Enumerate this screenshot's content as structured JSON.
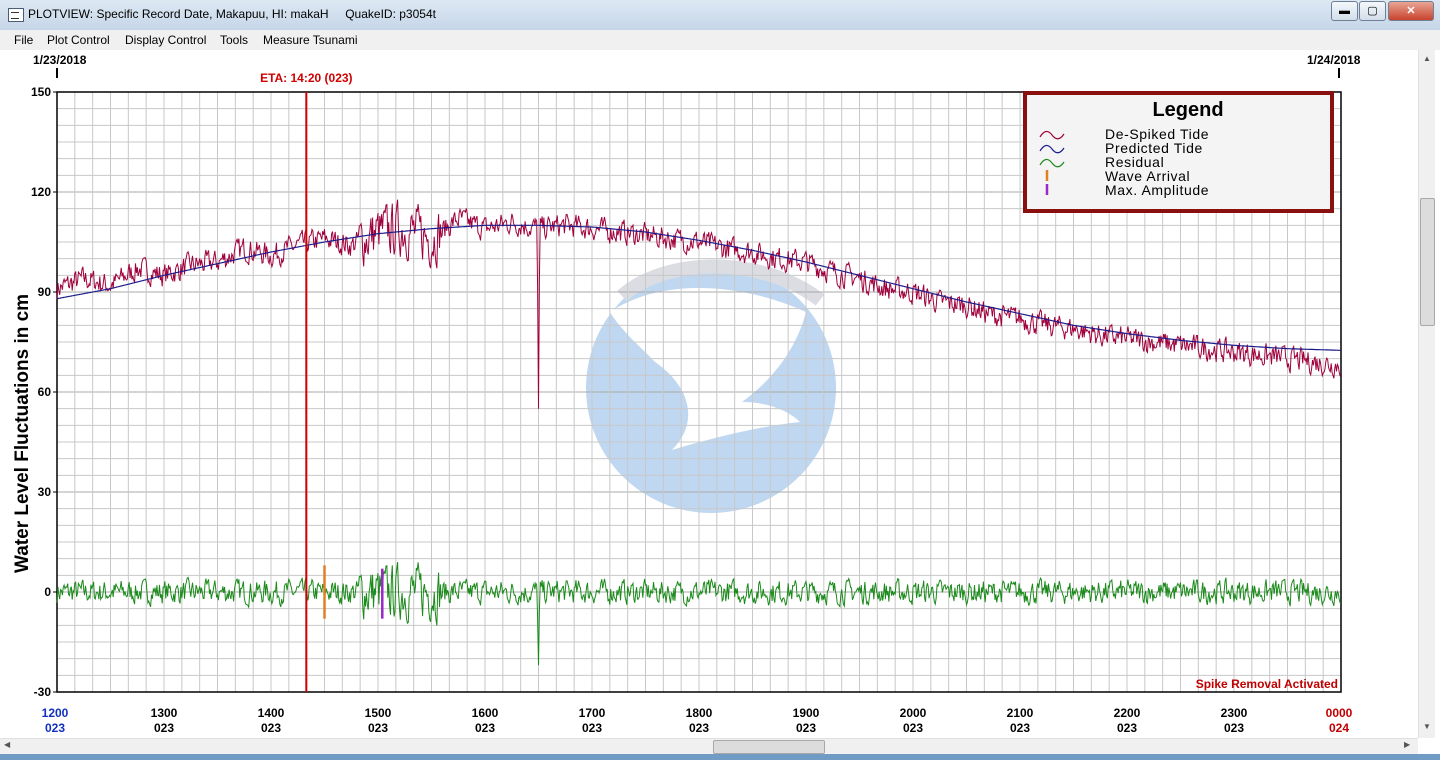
{
  "window": {
    "title": "PLOTVIEW: Specific Record Date, Makapuu, HI: makaH     QuakeID: p3054t",
    "minimize_label": "▬",
    "maximize_label": "▢",
    "close_label": "✕"
  },
  "menu": [
    "File",
    "Plot Control",
    "Display Control",
    "Tools",
    "Measure Tsunami"
  ],
  "colors": {
    "tide": "#a0003c",
    "predicted": "#1a1a8c",
    "residual": "#1a8a1a",
    "eta_line": "#d00000",
    "wave_arrival": "#e08020",
    "max_amplitude": "#9a28c8",
    "grid": "#c8c8c8",
    "legend_border": "#8a1010"
  },
  "chart_data": {
    "type": "line",
    "title": "",
    "ylabel": "Water Level Fluctuations in cm",
    "ylim": [
      -30,
      150
    ],
    "yticks": [
      150,
      120,
      90,
      60,
      30,
      0,
      -30
    ],
    "xlim": [
      12,
      24
    ],
    "start_date": "1/23/2018",
    "end_date": "1/24/2018",
    "x_tick_labels": [
      {
        "time": "1200",
        "day": "023"
      },
      {
        "time": "1300",
        "day": "023"
      },
      {
        "time": "1400",
        "day": "023"
      },
      {
        "time": "1500",
        "day": "023"
      },
      {
        "time": "1600",
        "day": "023"
      },
      {
        "time": "1700",
        "day": "023"
      },
      {
        "time": "1800",
        "day": "023"
      },
      {
        "time": "1900",
        "day": "023"
      },
      {
        "time": "2000",
        "day": "023"
      },
      {
        "time": "2100",
        "day": "023"
      },
      {
        "time": "2200",
        "day": "023"
      },
      {
        "time": "2300",
        "day": "023"
      },
      {
        "time": "0000",
        "day": "024"
      }
    ],
    "eta": {
      "label": "ETA: 14:20 (023)",
      "hour": 14.33
    },
    "wave_arrival_hour": 14.5,
    "max_amplitude_hour": 15.04,
    "status_text": "Spike Removal Activated",
    "legend": {
      "title": "Legend",
      "entries": [
        "De-Spiked Tide",
        "Predicted Tide",
        "Residual",
        "Wave Arrival",
        "Max. Amplitude"
      ]
    },
    "series": [
      {
        "name": "Predicted Tide",
        "x": [
          12,
          12.5,
          13,
          13.5,
          14,
          14.5,
          15,
          15.5,
          16,
          16.5,
          17,
          17.5,
          18,
          18.5,
          19,
          19.5,
          20,
          20.5,
          21,
          21.5,
          22,
          22.5,
          23,
          23.5,
          24
        ],
        "y": [
          88,
          91,
          95,
          98.5,
          102,
          105,
          107.5,
          109,
          110,
          110,
          109.5,
          108,
          105.5,
          102.5,
          99,
          95,
          91,
          87,
          83.5,
          80,
          77.5,
          75.5,
          74,
          73,
          72.5
        ]
      },
      {
        "name": "De-Spiked Tide",
        "x": [
          12,
          12.25,
          12.5,
          12.75,
          13,
          13.25,
          13.5,
          13.75,
          14,
          14.25,
          14.5,
          14.75,
          15,
          15.25,
          15.5,
          15.75,
          16,
          16.25,
          16.5,
          16.75,
          17,
          17.25,
          17.5,
          17.75,
          18,
          18.25,
          18.5,
          18.75,
          19,
          19.25,
          19.5,
          19.75,
          20,
          20.25,
          20.5,
          20.75,
          21,
          21.25,
          21.5,
          21.75,
          22,
          22.25,
          22.5,
          22.75,
          23,
          23.25,
          23.5,
          23.75,
          24
        ],
        "y": [
          91,
          94,
          92,
          97,
          95,
          98,
          99,
          103,
          101,
          104,
          106,
          104,
          108,
          109,
          106,
          112,
          109,
          111,
          109,
          110,
          109,
          108,
          107,
          106,
          105,
          103,
          102,
          100,
          99,
          96,
          94,
          91,
          90,
          87,
          86,
          83,
          82,
          80,
          79,
          77,
          76,
          75,
          74,
          73,
          72,
          71,
          70,
          69,
          68
        ]
      },
      {
        "name": "Residual",
        "x": [
          12,
          12.5,
          13,
          13.5,
          14,
          14.5,
          15,
          15.5,
          16,
          16.5,
          17,
          17.5,
          18,
          18.5,
          19,
          19.5,
          20,
          20.5,
          21,
          21.5,
          22,
          22.5,
          23,
          23.5,
          24
        ],
        "y": [
          0,
          0,
          0,
          0,
          0,
          0,
          0,
          0,
          0,
          0,
          0,
          0,
          0,
          0,
          0,
          0,
          0,
          0,
          0,
          0,
          0,
          0,
          0,
          0,
          0
        ]
      }
    ],
    "spike": {
      "hour": 16.5,
      "tide_min": 55,
      "residual_min": -22
    }
  }
}
